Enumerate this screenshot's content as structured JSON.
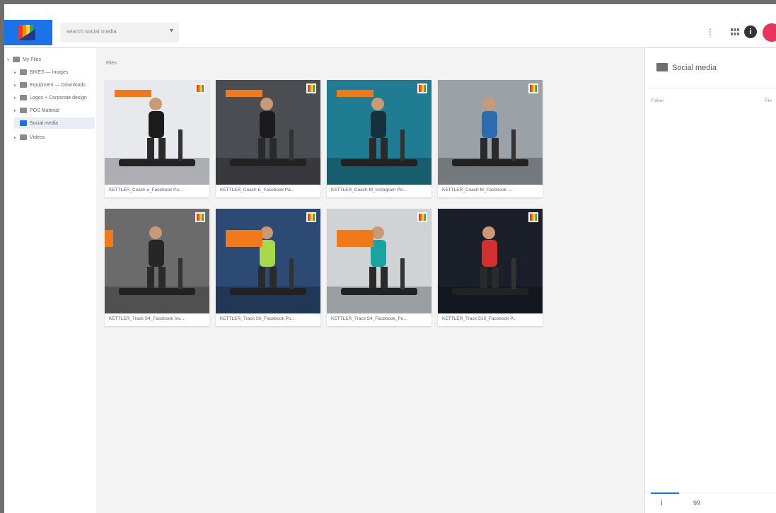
{
  "app": {
    "search_placeholder": "search social media"
  },
  "sidebar": {
    "items": [
      {
        "label": "My Files",
        "level": 0,
        "active": false
      },
      {
        "label": "BIKES — Images",
        "level": 1,
        "active": false
      },
      {
        "label": "Equipment — Downloads",
        "level": 1,
        "active": false
      },
      {
        "label": "Logos + Corporate design",
        "level": 1,
        "active": false
      },
      {
        "label": "POS Material",
        "level": 1,
        "active": false
      },
      {
        "label": "Social media",
        "level": 1,
        "active": true
      },
      {
        "label": "Videos",
        "level": 1,
        "active": false
      }
    ]
  },
  "main": {
    "section_label": "Files",
    "files": [
      {
        "name": "KETTLER_Coach e_Facebook Po...",
        "bg": "#e7e9ec",
        "accent": "#1c1c1c"
      },
      {
        "name": "KETTLER_Coach E_Facebook Pa...",
        "bg": "#4a4d52",
        "accent": "#1b1b1b"
      },
      {
        "name": "KETTLER_Coach M_Instagram Po...",
        "bg": "#1f7c93",
        "accent": "#16323c"
      },
      {
        "name": "KETTLER_Coach M_Facebook ...",
        "bg": "#9aa2a7",
        "accent": "#2b6cb0"
      },
      {
        "name": "KETTLER_Track S4_Facebook Inv...",
        "bg": "#6b6b6b",
        "accent": "#262626"
      },
      {
        "name": "KETTLER_Track S6_Facebook Po...",
        "bg": "#2c4a73",
        "accent": "#a8d94a"
      },
      {
        "name": "KETTLER_Track S4_Facebook_Po...",
        "bg": "#cfd3d6",
        "accent": "#1aa3a3"
      },
      {
        "name": "KETTLER_Track S10_Facebook P...",
        "bg": "#1a1f2a",
        "accent": "#d32f2f"
      }
    ]
  },
  "details": {
    "title": "Social media",
    "row_label": "Folder",
    "row_value": "File"
  },
  "icons": {
    "kebab": "more-vert-icon",
    "grid": "grid-view-icon",
    "info": "info-icon",
    "info_glyph": "i",
    "tab_info": "i",
    "tab_tags": "99"
  },
  "colors": {
    "brand_blue": "#1a73e8",
    "avatar": "#e8335c",
    "promo_orange": "#f07a1a"
  }
}
